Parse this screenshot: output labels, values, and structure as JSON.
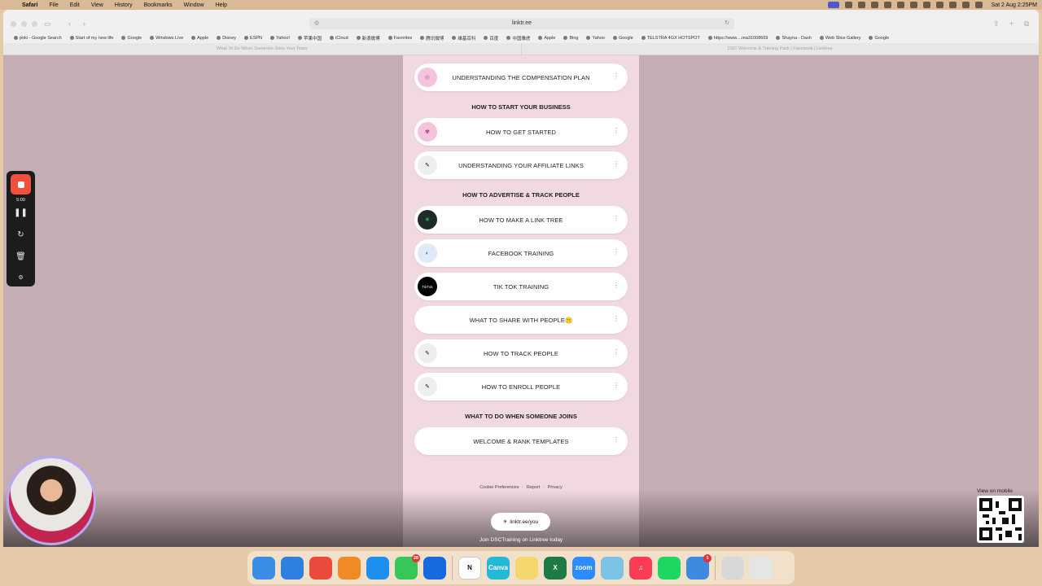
{
  "menubar": {
    "app": "Safari",
    "items": [
      "File",
      "Edit",
      "View",
      "History",
      "Bookmarks",
      "Window",
      "Help"
    ],
    "datetime": "Sat 2 Aug  2:25PM"
  },
  "browser": {
    "url": "linktr.ee",
    "bookmarks": [
      "poki - Google Search",
      "Start of my new life",
      "Google",
      "Windows Live",
      "Apple",
      "Disney",
      "ESPN",
      "Yahoo!",
      "苹果中国",
      "iCloud",
      "新浪微博",
      "Favorites",
      "腾讯微博",
      "维基百科",
      "百度",
      "中国雅虎",
      "Apple",
      "Bing",
      "Yahoo",
      "Google",
      "TELSTRA 4GX HOTSPOT",
      "https://www....rea31008669",
      "Shayna - Dash",
      "Web Slice Gallery",
      "Google"
    ],
    "tabs": [
      "What To Do When Someone Joins Your Team",
      "DSC Welcome & Training Pack | Facebook | Linktree"
    ]
  },
  "linktree": {
    "top_link": "UNDERSTANDING THE COMPENSATION PLAN",
    "section1": "HOW TO START YOUR BUSINESS",
    "links1": [
      "HOW TO GET STARTED",
      "UNDERSTANDING YOUR AFFILIATE LINKS"
    ],
    "section2": "HOW TO ADVERTISE & TRACK PEOPLE",
    "links2": [
      "HOW TO MAKE A LINK TREE",
      "FACEBOOK TRAINING",
      "TIK TOK TRAINING",
      "WHAT TO SHARE WITH PEOPLE🤫",
      "HOW TO TRACK PEOPLE",
      "HOW TO ENROLL PEOPLE"
    ],
    "section3": "WHAT TO DO WHEN SOMEONE JOINS",
    "links3": [
      "WELCOME & RANK TEMPLATES"
    ],
    "footer": [
      "Cookie Preferences",
      "Report",
      "Privacy"
    ],
    "cta_button": "linktr.ee/you",
    "cta_text": "Join DSCTraining on Linktree today",
    "tiktok_thumb_text": "TikTok"
  },
  "view_on_mobile": "View on mobile",
  "recorder": {
    "time": "5:00"
  },
  "dock": {
    "apps": [
      {
        "name": "Finder",
        "color": "#3a8ee6",
        "label": ""
      },
      {
        "name": "Safari",
        "color": "#2f7fe0",
        "label": ""
      },
      {
        "name": "Chrome",
        "color": "#e84a3c",
        "label": ""
      },
      {
        "name": "Books",
        "color": "#f08a24",
        "label": ""
      },
      {
        "name": "App Store",
        "color": "#1f8ef1",
        "label": ""
      },
      {
        "name": "Messages",
        "color": "#35c759",
        "label": "",
        "badge": "28"
      },
      {
        "name": "Dashlane",
        "color": "#1769e0",
        "label": ""
      },
      {
        "name": "Notion",
        "color": "#ffffff",
        "label": "N"
      },
      {
        "name": "Canva",
        "color": "#21b9d6",
        "label": "Canva"
      },
      {
        "name": "Notes",
        "color": "#f5d76e",
        "label": ""
      },
      {
        "name": "Excel",
        "color": "#1d7a45",
        "label": "X"
      },
      {
        "name": "Zoom",
        "color": "#2d8cff",
        "label": "zoom"
      },
      {
        "name": "Maps",
        "color": "#7cc3e8",
        "label": ""
      },
      {
        "name": "Music",
        "color": "#fa3c55",
        "label": "♫"
      },
      {
        "name": "Spotify",
        "color": "#1ed760",
        "label": ""
      },
      {
        "name": "Mail",
        "color": "#3f8ae0",
        "label": "",
        "badge": "1"
      },
      {
        "name": "Preview",
        "color": "#d8d8d8",
        "label": ""
      },
      {
        "name": "Trash",
        "color": "#e5e5e5",
        "label": ""
      }
    ]
  }
}
